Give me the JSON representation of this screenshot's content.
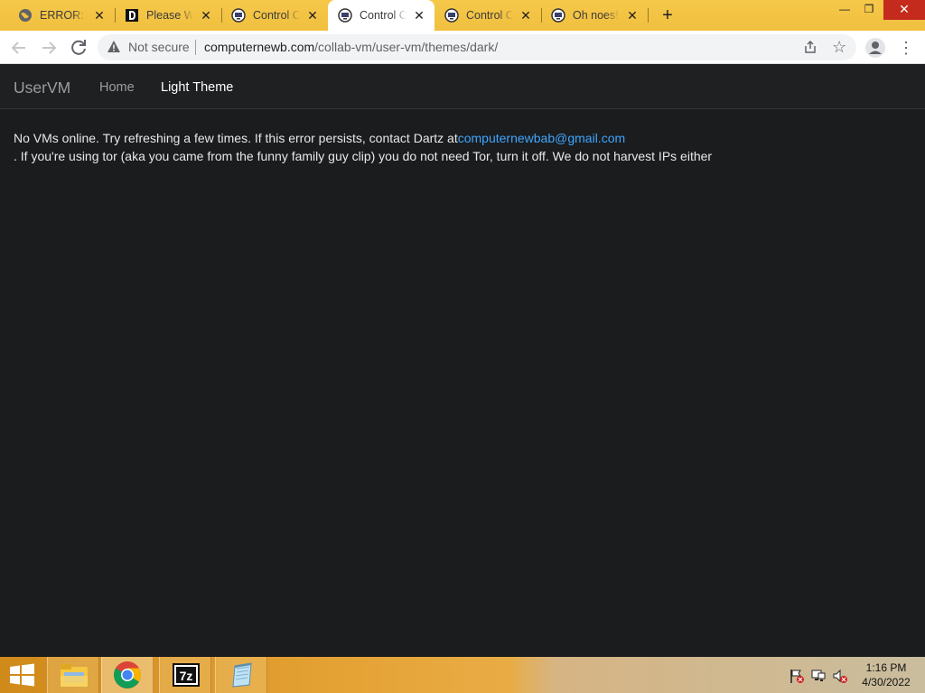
{
  "browser": {
    "tabs": [
      {
        "title": "ERROR: The",
        "icon": "globe-icon",
        "active": false
      },
      {
        "title": "Please Wait",
        "icon": "d-logo-icon",
        "active": false
      },
      {
        "title": "Control Collab",
        "icon": "collabvm-icon",
        "active": false
      },
      {
        "title": "Control Collab",
        "icon": "collabvm-icon",
        "active": true
      },
      {
        "title": "Control Collab",
        "icon": "collabvm-icon",
        "active": false
      },
      {
        "title": "Oh noes!",
        "icon": "collabvm-icon",
        "active": false
      }
    ],
    "new_tab": "+",
    "window_controls": {
      "minimize": "—",
      "restore": "❐",
      "close": "✕"
    },
    "address": {
      "security_label": "Not secure",
      "host": "computernewb.com",
      "path": "/collab-vm/user-vm/themes/dark/"
    }
  },
  "page": {
    "brand": "UserVM",
    "nav": {
      "home": "Home",
      "light_theme": "Light Theme"
    },
    "message": {
      "line1_prefix": "No VMs online. Try refreshing a few times. If this error persists, contact Dartz at",
      "email": "computernewbab@gmail.com",
      "line2": ". If you're using tor (aka you came from the funny family guy clip) you do not need Tor, turn it off. We do not harvest IPs either"
    }
  },
  "taskbar": {
    "items": [
      "start-button",
      "file-explorer",
      "chrome",
      "7zip",
      "notepad"
    ],
    "clock": {
      "time": "1:16 PM",
      "date": "4/30/2022"
    }
  },
  "colors": {
    "tab_strip": "#f0bf3e",
    "page_bg": "#1b1c1e",
    "link": "#3ea6ff"
  }
}
